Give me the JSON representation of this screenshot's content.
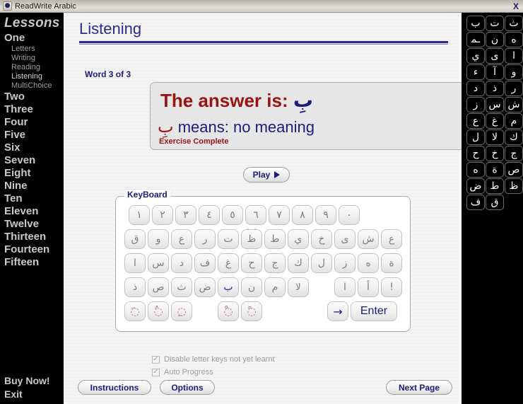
{
  "window": {
    "title": "ReadWrite Arabic",
    "close_label": "X",
    "icon": "book-icon"
  },
  "sidebar": {
    "heading": "Lessons",
    "lessons": [
      {
        "label": "One",
        "sub": [
          "Letters",
          "Writing",
          "Reading",
          "Listening",
          "MultiChoice"
        ],
        "active_sub": "Listening"
      },
      {
        "label": "Two",
        "sub": []
      },
      {
        "label": "Three",
        "sub": []
      },
      {
        "label": "Four",
        "sub": []
      },
      {
        "label": "Five",
        "sub": []
      },
      {
        "label": "Six",
        "sub": []
      },
      {
        "label": "Seven",
        "sub": []
      },
      {
        "label": "Eight",
        "sub": []
      },
      {
        "label": "Nine",
        "sub": []
      },
      {
        "label": "Ten",
        "sub": []
      },
      {
        "label": "Eleven",
        "sub": []
      },
      {
        "label": "Twelve",
        "sub": []
      },
      {
        "label": "Thirteen",
        "sub": []
      },
      {
        "label": "Fourteen",
        "sub": []
      },
      {
        "label": "Fifteen",
        "sub": []
      }
    ],
    "buy_now": "Buy Now!",
    "exit": "Exit"
  },
  "main": {
    "page_title": "Listening",
    "word_counter": "Word 3 of 3",
    "answer": {
      "prefix": "The answer is:",
      "letter": "بِ",
      "means_word": "بِ",
      "means_label": "means:",
      "meaning": "no meaning",
      "status": "Exercise Complete"
    },
    "play_label": "Play",
    "keyboard": {
      "legend": "KeyBoard",
      "rows": [
        [
          "١",
          "٢",
          "٣",
          "٤",
          "٥",
          "٦",
          "٧",
          "٨",
          "٩",
          "٠"
        ],
        [
          "ق",
          "و",
          "ع",
          "ر",
          "ت",
          "ظ",
          "ط",
          "ي",
          "خ",
          "ى",
          "ش",
          "ع"
        ],
        [
          "ا",
          "س",
          "د",
          "ف",
          "غ",
          "ح",
          "ج",
          "ك",
          "ل",
          "ز",
          "ه",
          "ة"
        ],
        [
          "ذ",
          "ص",
          "ث",
          "ض",
          "ب",
          "ن",
          "م",
          "لا",
          "",
          "ا",
          "أ",
          "!"
        ],
        [
          "َ",
          "ُ",
          "ِ",
          "",
          "ْ",
          "ً"
        ]
      ],
      "answer_key": "ب",
      "enter_label": "Enter",
      "arrow_label": "→"
    },
    "options": {
      "disable_keys": "Disable letter keys not yet learnt",
      "auto_progress": "Auto Progress",
      "disable_keys_checked": true,
      "auto_progress_checked": true
    },
    "buttons": {
      "instructions": "Instructions",
      "options": "Options",
      "next_page": "Next Page"
    }
  },
  "alphabet_panel": {
    "keys": [
      "ث",
      "ت",
      "ب",
      "ه",
      "ن",
      "ـﻤ",
      "ا",
      "ى",
      "ي",
      "و",
      "آ",
      "ء",
      "ر",
      "ذ",
      "د",
      "ش",
      "س",
      "ز",
      "م",
      "غ",
      "ع",
      "ك",
      "لا",
      "ل",
      "ج",
      "خ",
      "ح",
      "ص",
      "ة",
      "ه",
      "ظ",
      "ط",
      "ض",
      "",
      "ق",
      "ف"
    ]
  },
  "colors": {
    "accent_blue": "#1b1b7a",
    "answer_red": "#9b1313",
    "sidebar_bg": "#000000",
    "panel_bg": "#e6e6e6"
  }
}
